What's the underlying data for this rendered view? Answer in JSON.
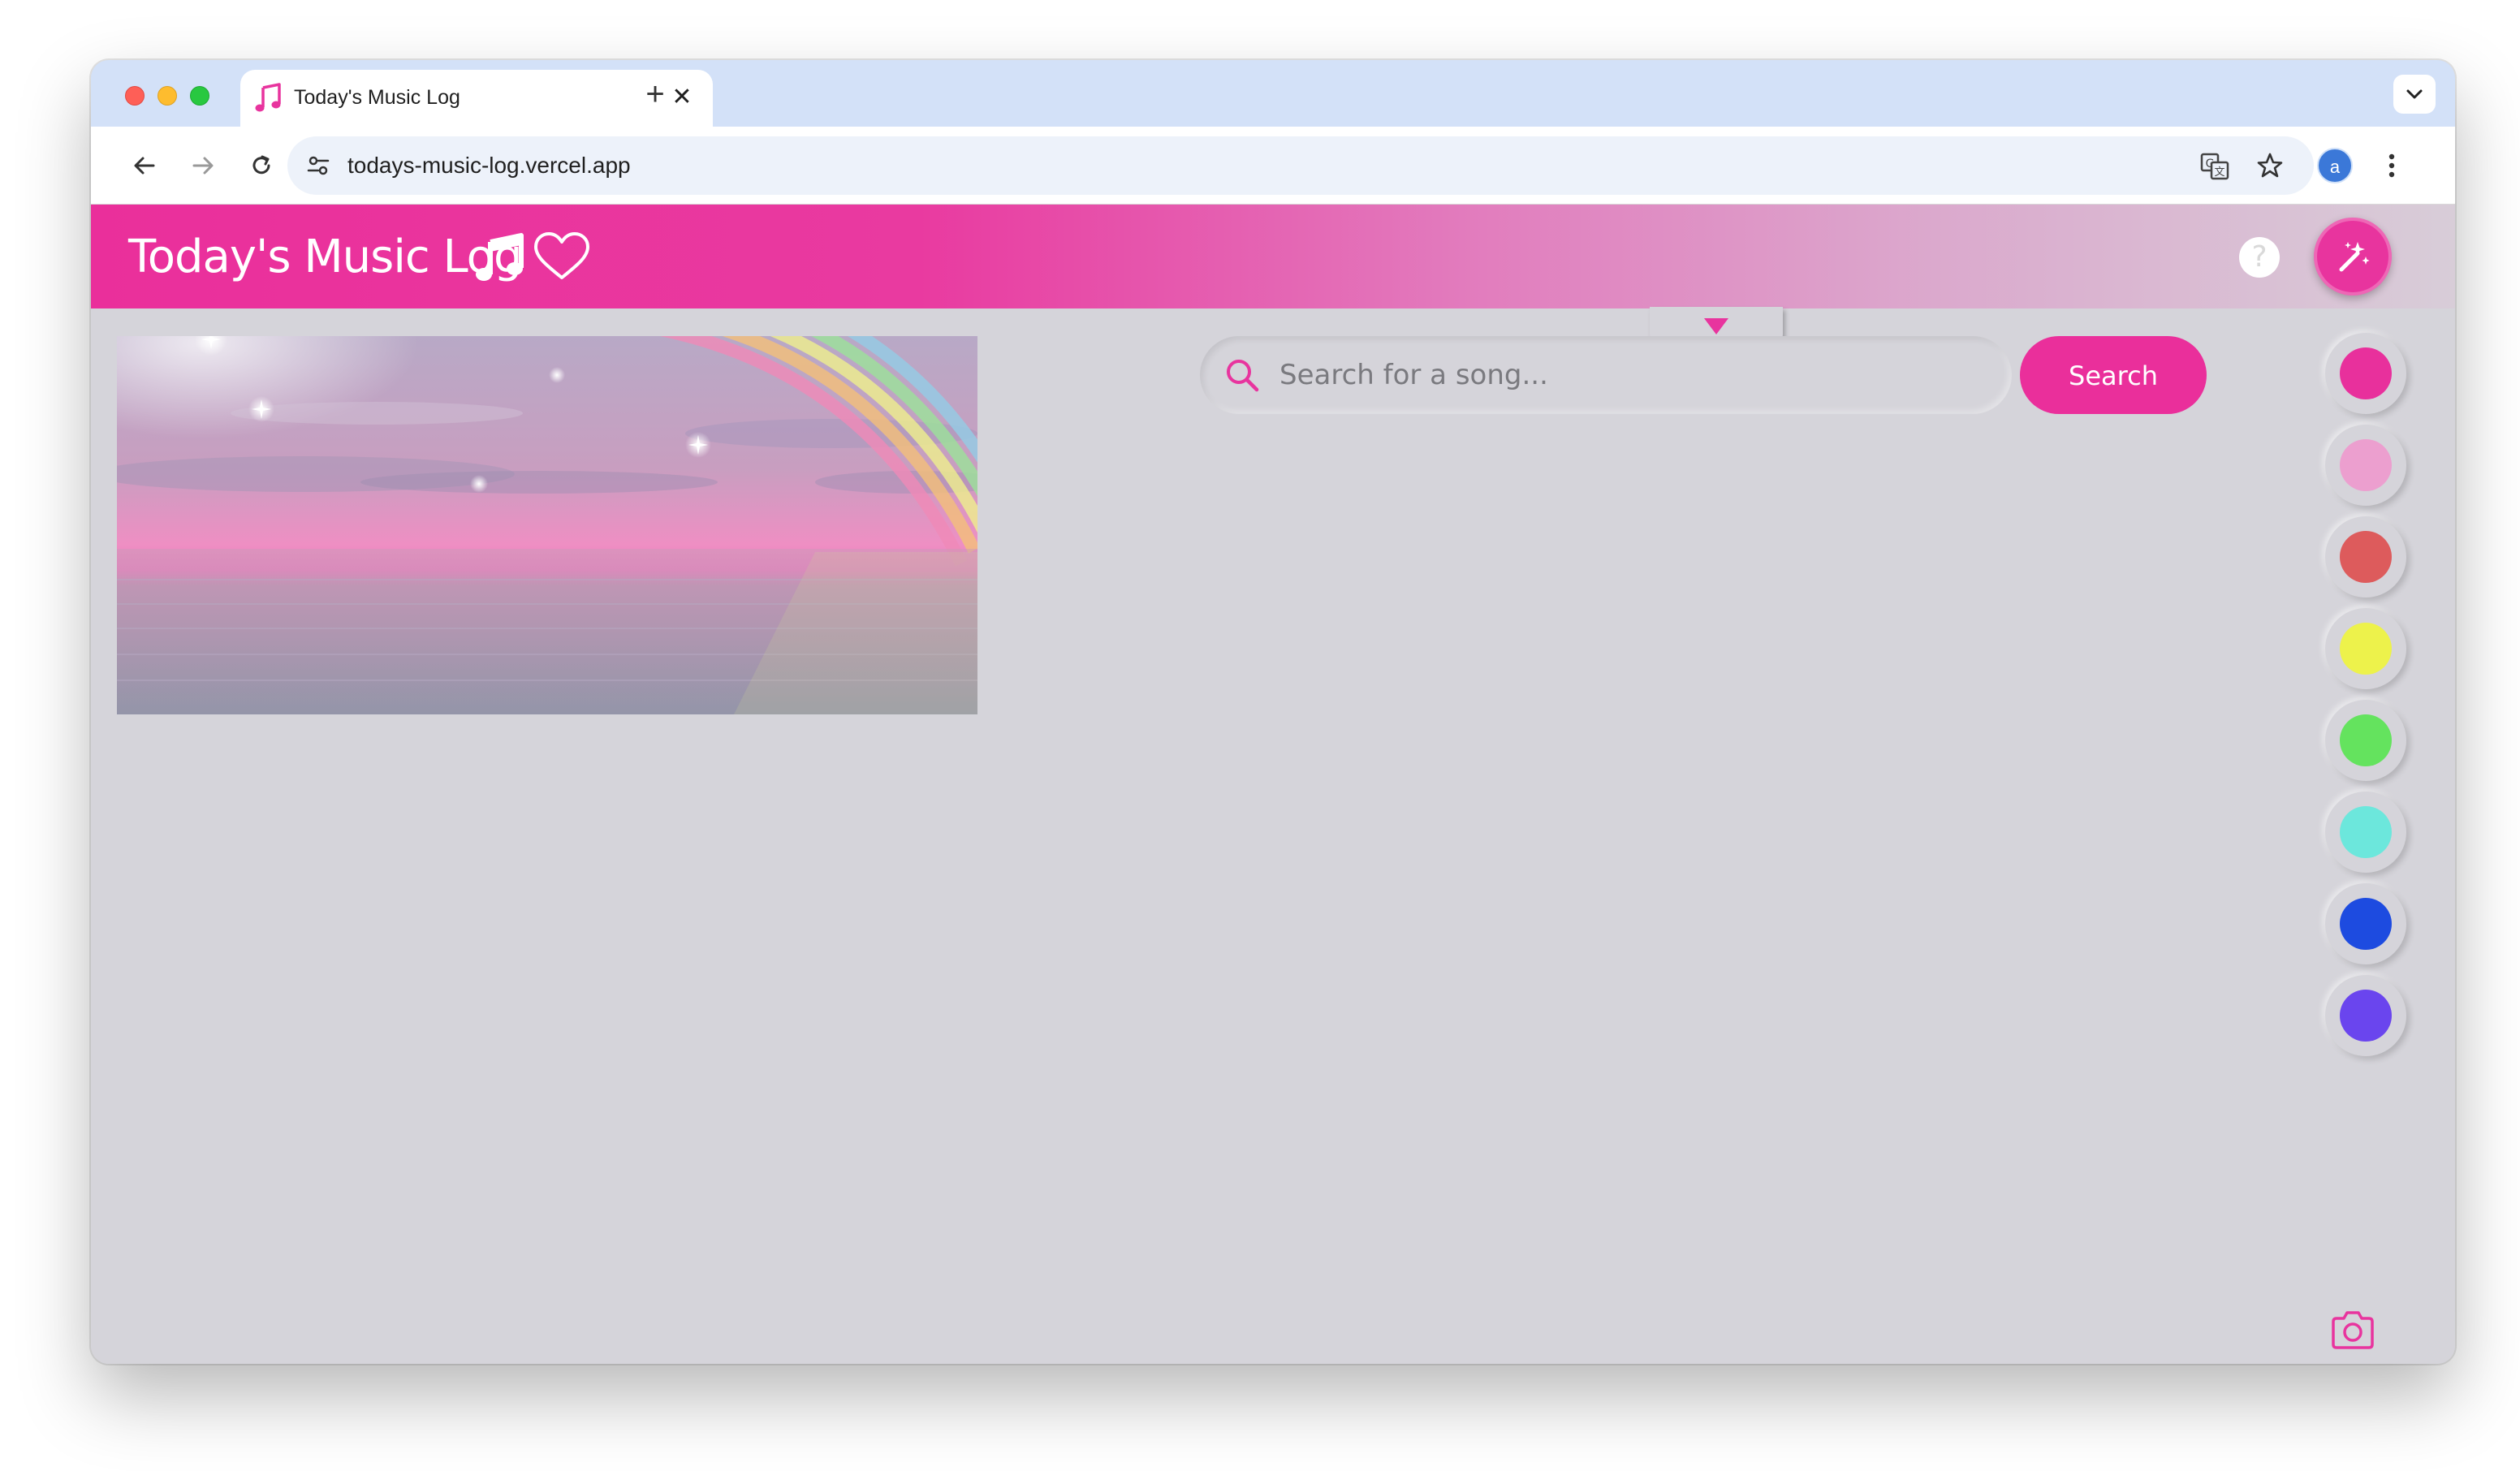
{
  "browser": {
    "tab": {
      "title": "Today's Music Log",
      "icon": "music-note-icon",
      "close_icon": "close-icon"
    },
    "new_tab_icon": "plus-icon",
    "tab_search_icon": "chevron-down-icon",
    "nav": {
      "back_icon": "arrow-left-icon",
      "forward_icon": "arrow-right-icon",
      "reload_icon": "reload-icon"
    },
    "url": "todays-music-log.vercel.app",
    "omnibox_icons": [
      "site-info-icon",
      "translate-icon",
      "star-icon"
    ],
    "profile_initial": "a",
    "menu_icon": "kebab-icon"
  },
  "app": {
    "title": "Today's Music Log",
    "title_icons": [
      "music-note-icon",
      "heart-icon"
    ],
    "help_label": "?",
    "magic_icon": "magic-wand-icon",
    "header_gradient": [
      "#ea2f9b",
      "#e27bbd",
      "#d8cdd8"
    ],
    "accent": "#ea2f9b",
    "background": "#d5d4da"
  },
  "scene": {
    "description_icon": "rainbow-sea-image"
  },
  "search": {
    "placeholder": "Search for a song...",
    "button_label": "Search",
    "icon": "search-icon"
  },
  "color_swatches": [
    {
      "name": "hot-pink",
      "color": "#e8309c"
    },
    {
      "name": "light-pink",
      "color": "#ec9fcf"
    },
    {
      "name": "coral-red",
      "color": "#dd5b5c"
    },
    {
      "name": "yellow",
      "color": "#edf24b"
    },
    {
      "name": "green",
      "color": "#64e35e"
    },
    {
      "name": "aqua",
      "color": "#6ce7dc"
    },
    {
      "name": "blue",
      "color": "#1d4be0"
    },
    {
      "name": "violet",
      "color": "#6a45ee"
    }
  ],
  "camera_icon": "camera-icon"
}
